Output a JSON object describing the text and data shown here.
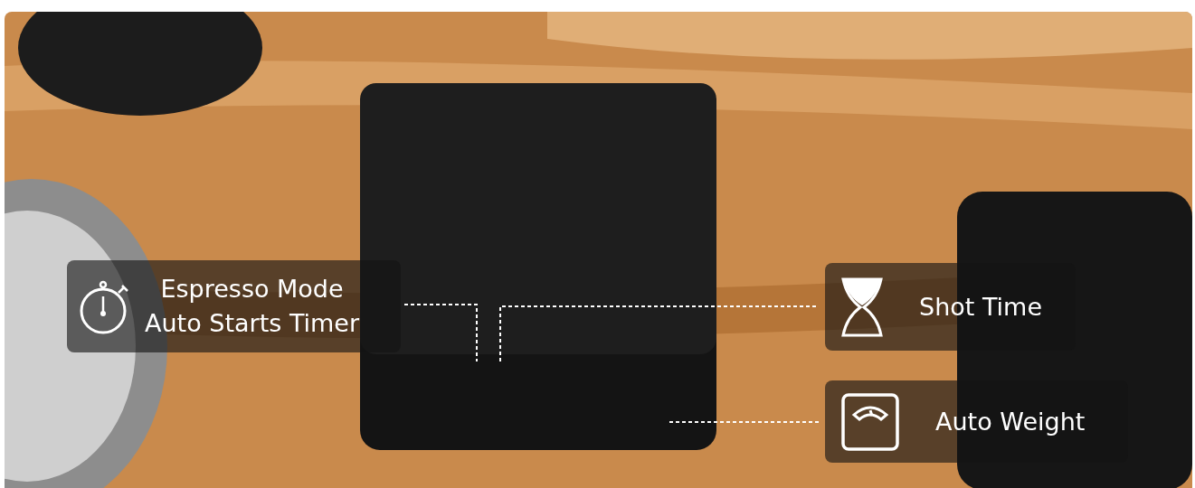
{
  "callouts": [
    {
      "lines": [
        "Espresso Mode",
        "Auto Starts Timer"
      ]
    },
    {
      "lines": [
        "Shot Time"
      ]
    },
    {
      "lines": [
        "Auto Weight"
      ]
    }
  ]
}
